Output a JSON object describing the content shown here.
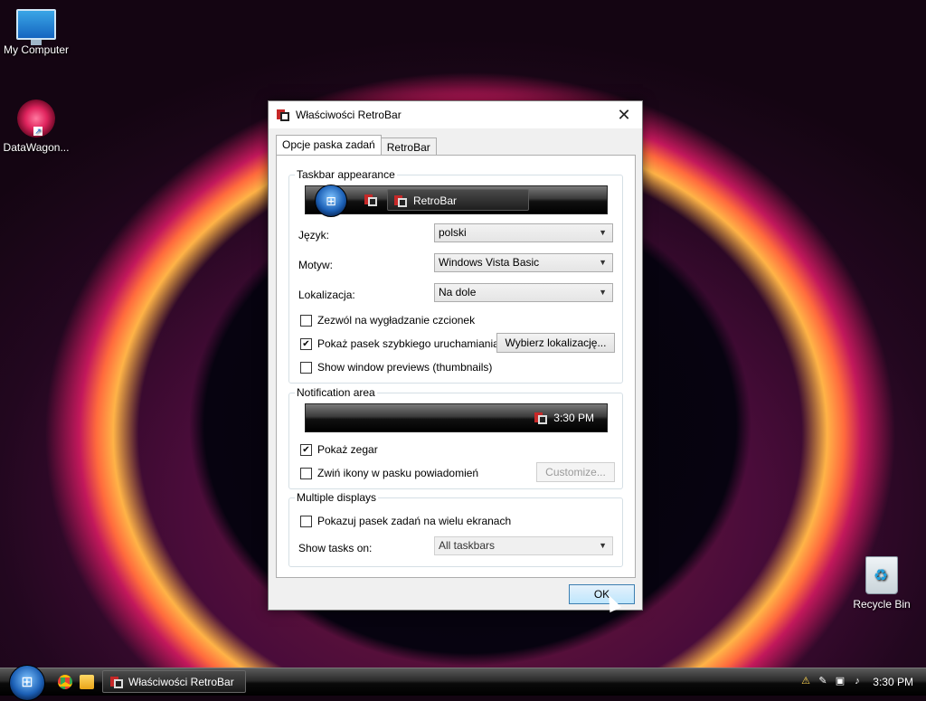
{
  "desktop": {
    "icons": [
      {
        "label": "My Computer"
      },
      {
        "label": "DataWagon..."
      },
      {
        "label": "Recycle Bin"
      }
    ]
  },
  "dialog": {
    "title": "Właściwości RetroBar",
    "close_glyph": "✕",
    "tabs": [
      {
        "label": "Opcje paska zadań",
        "active": true
      },
      {
        "label": "RetroBar",
        "active": false
      }
    ],
    "appearance": {
      "legend": "Taskbar appearance",
      "preview_button_label": "RetroBar",
      "language_label": "Język:",
      "language_value": "polski",
      "theme_label": "Motyw:",
      "theme_value": "Windows Vista Basic",
      "location_label": "Lokalizacja:",
      "location_value": "Na dole",
      "font_smoothing_label": "Zezwól na wygładzanie czcionek",
      "font_smoothing_checked": false,
      "quick_launch_label": "Pokaż pasek szybkiego uruchamiania",
      "quick_launch_checked": true,
      "choose_location_button": "Wybierz lokalizację...",
      "thumbnails_label": "Show window previews (thumbnails)",
      "thumbnails_checked": false
    },
    "notification": {
      "legend": "Notification area",
      "preview_clock": "3:30 PM",
      "show_clock_label": "Pokaż zegar",
      "show_clock_checked": true,
      "collapse_icons_label": "Zwiń ikony w pasku powiadomień",
      "collapse_icons_checked": false,
      "customize_button": "Customize..."
    },
    "multi": {
      "legend": "Multiple displays",
      "show_all_label": "Pokazuj pasek zadań na wielu ekranach",
      "show_all_checked": false,
      "show_tasks_label": "Show tasks on:",
      "show_tasks_value": "All taskbars"
    },
    "ok_button": "OK"
  },
  "taskbar": {
    "window_button": "Właściwości RetroBar",
    "clock": "3:30 PM"
  },
  "colors": {
    "accent": "#3c7fb1",
    "desktop_glow": "#ff6a3d"
  }
}
